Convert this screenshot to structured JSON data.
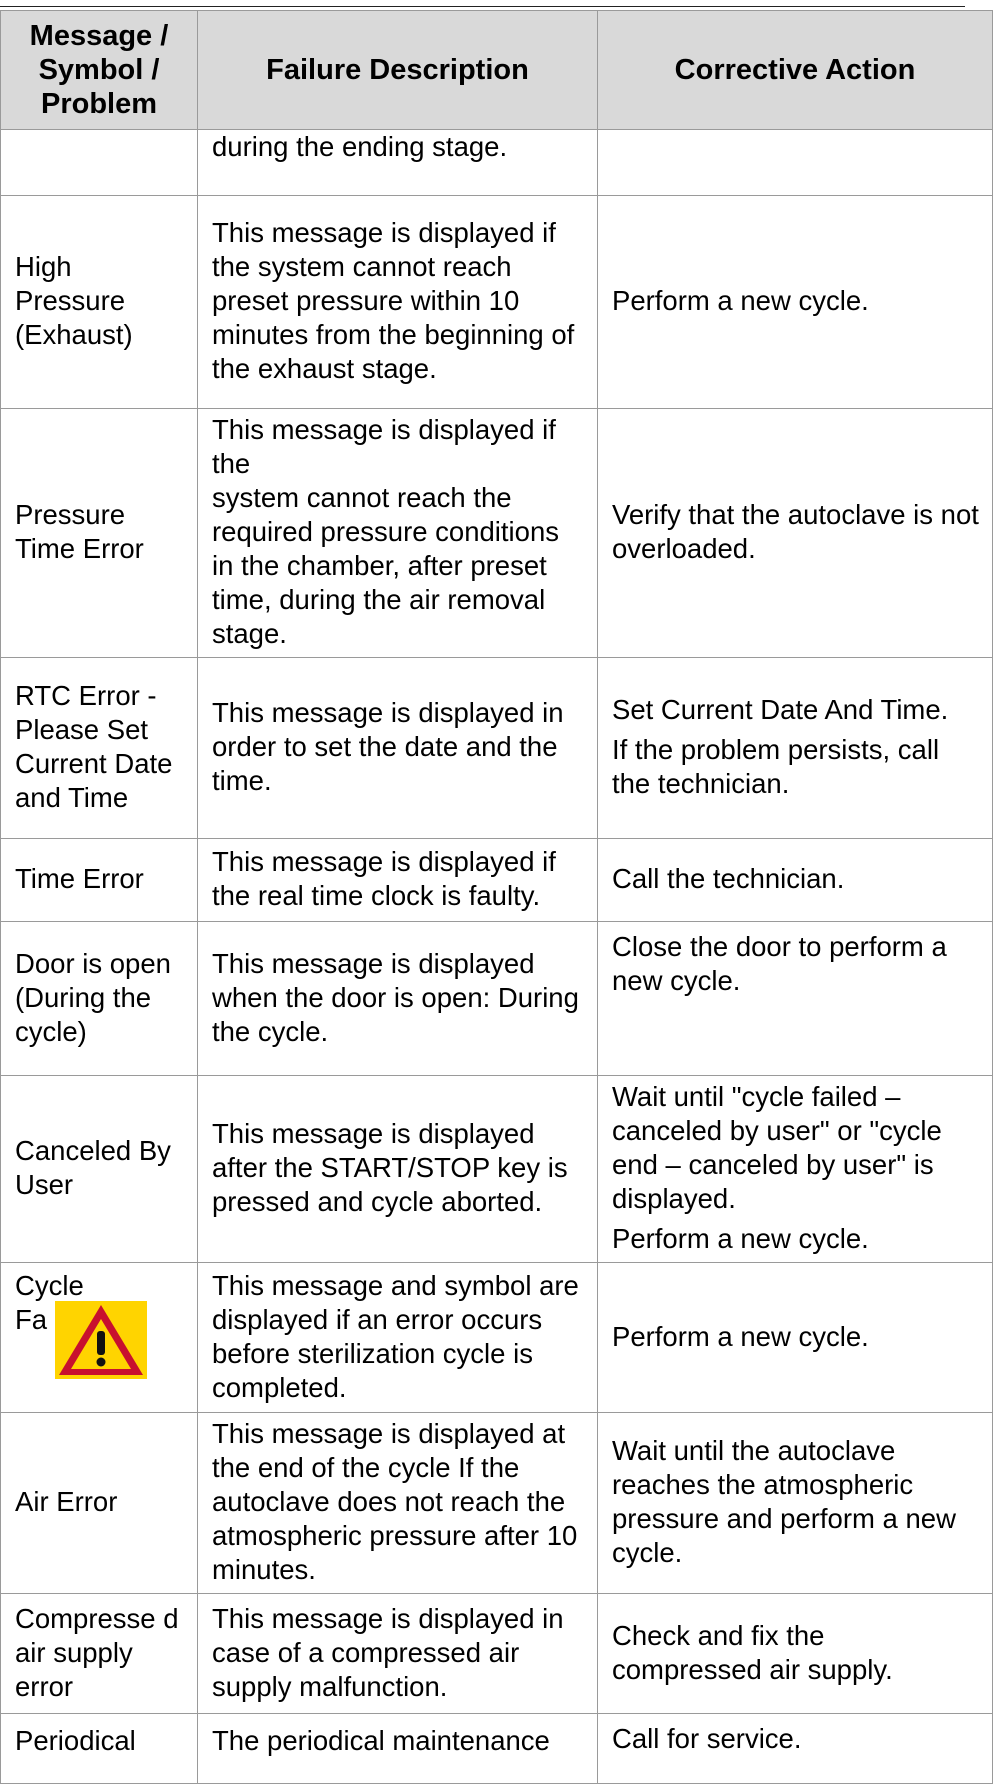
{
  "headers": {
    "message": "Message / Symbol / Problem",
    "failure": "Failure Description",
    "action": "Corrective Action"
  },
  "rows": [
    {
      "message": "",
      "failure": "during the ending stage.",
      "action": []
    },
    {
      "message": "High Pressure (Exhaust)",
      "failure": "This message is displayed if the system cannot reach preset pressure within 10 minutes from the beginning of the exhaust stage.",
      "action": [
        "Perform a new cycle."
      ]
    },
    {
      "message": "Pressure Time Error",
      "failure": "This message is displayed if the\nsystem cannot reach the required pressure conditions in the chamber, after preset time, during the air removal stage.",
      "action": [
        "Verify that the autoclave is not overloaded."
      ]
    },
    {
      "message": "RTC Error - Please Set Current Date and Time",
      "failure": "This message is displayed in order to set the date and the time.",
      "action": [
        "Set Current Date And Time.",
        "If the problem persists, call the technician."
      ]
    },
    {
      "message": "Time Error",
      "failure": "This message is displayed if the real time clock is faulty.",
      "action": [
        "Call the technician."
      ]
    },
    {
      "message": "Door is open (During the cycle)",
      "failure": "This message is displayed when the door is open: During the cycle.",
      "action": [
        "Close the door to perform a new cycle."
      ]
    },
    {
      "message": "Canceled By User",
      "failure": "This message is displayed after the START/STOP key is pressed and cycle aborted.",
      "action": [
        "Wait until \"cycle failed – canceled by user\" or \"cycle end – canceled by user\" is displayed.",
        "Perform a new cycle."
      ]
    },
    {
      "message": "Cycle Fa",
      "icon": "warning-triangle-icon",
      "failure": "This message and symbol are displayed if an error occurs before sterilization cycle is completed.",
      "action": [
        "Perform a new cycle."
      ]
    },
    {
      "message": "Air Error",
      "failure": "This message is displayed at the end of the cycle If the autoclave does not reach the atmospheric pressure after 10 minutes.",
      "action": [
        "Wait until the autoclave reaches the atmospheric pressure and perform a new cycle."
      ]
    },
    {
      "message": "Compresse d air supply error",
      "failure": "This message is displayed in case of a compressed air supply malfunction.",
      "action": [
        "Check and fix the compressed air supply."
      ]
    },
    {
      "message": "Periodical",
      "failure": "The periodical maintenance",
      "action": [
        "Call for service."
      ]
    }
  ],
  "colors": {
    "header_bg": "#d9d9d9",
    "border": "#9a9a9a",
    "warning_fill": "#ffd400",
    "warning_border": "#c8102e"
  }
}
